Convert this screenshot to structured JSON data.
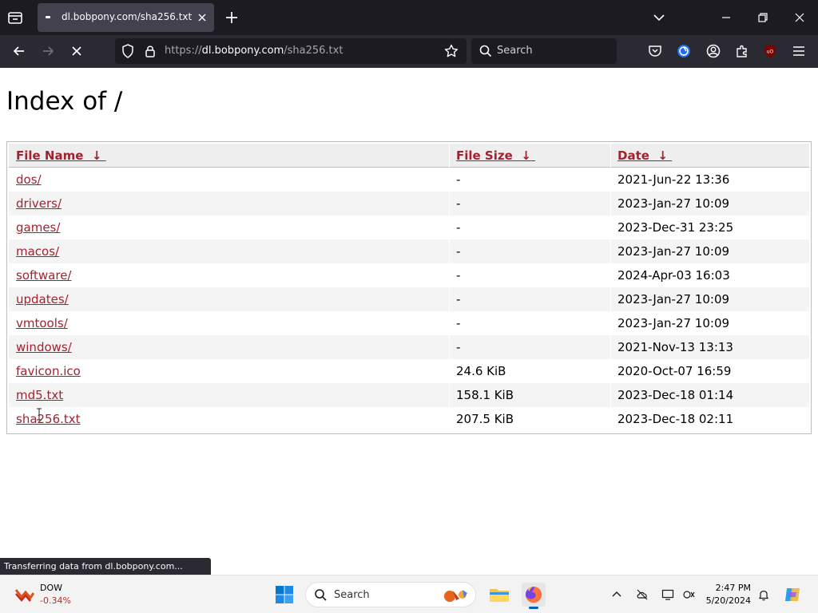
{
  "browser": {
    "tab": {
      "title": "dl.bobpony.com/sha256.txt"
    },
    "url": {
      "prefix": "https://",
      "host": "dl.bobpony.com",
      "path": "/sha256.txt"
    },
    "search_placeholder": "Search"
  },
  "page": {
    "title": "Index of /",
    "table": {
      "headers": {
        "name": "File Name",
        "size": "File Size",
        "date": "Date",
        "sort_arrow": "↓"
      },
      "rows": [
        {
          "name": "dos/",
          "size": "-",
          "date": "2021-Jun-22 13:36"
        },
        {
          "name": "drivers/",
          "size": "-",
          "date": "2023-Jan-27 10:09"
        },
        {
          "name": "games/",
          "size": "-",
          "date": "2023-Dec-31 23:25"
        },
        {
          "name": "macos/",
          "size": "-",
          "date": "2023-Jan-27 10:09"
        },
        {
          "name": "software/",
          "size": "-",
          "date": "2024-Apr-03 16:03"
        },
        {
          "name": "updates/",
          "size": "-",
          "date": "2023-Jan-27 10:09"
        },
        {
          "name": "vmtools/",
          "size": "-",
          "date": "2023-Jan-27 10:09"
        },
        {
          "name": "windows/",
          "size": "-",
          "date": "2021-Nov-13 13:13"
        },
        {
          "name": "favicon.ico",
          "size": "24.6 KiB",
          "date": "2020-Oct-07 16:59"
        },
        {
          "name": "md5.txt",
          "size": "158.1 KiB",
          "date": "2023-Dec-18 01:14"
        },
        {
          "name": "sha256.txt",
          "size": "207.5 KiB",
          "date": "2023-Dec-18 02:11"
        }
      ]
    }
  },
  "status_bar": {
    "text": "Transferring data from dl.bobpony.com..."
  },
  "taskbar": {
    "widget": {
      "name": "DOW",
      "change": "-0.34%"
    },
    "search_placeholder": "Search",
    "clock": {
      "time": "2:47 PM",
      "date": "5/20/2024"
    }
  },
  "colors": {
    "link": "#a4212e",
    "tab_bg": "#1c1b22",
    "toolbar_bg": "#2b2a33",
    "ticker_negative": "#c42b1c"
  }
}
